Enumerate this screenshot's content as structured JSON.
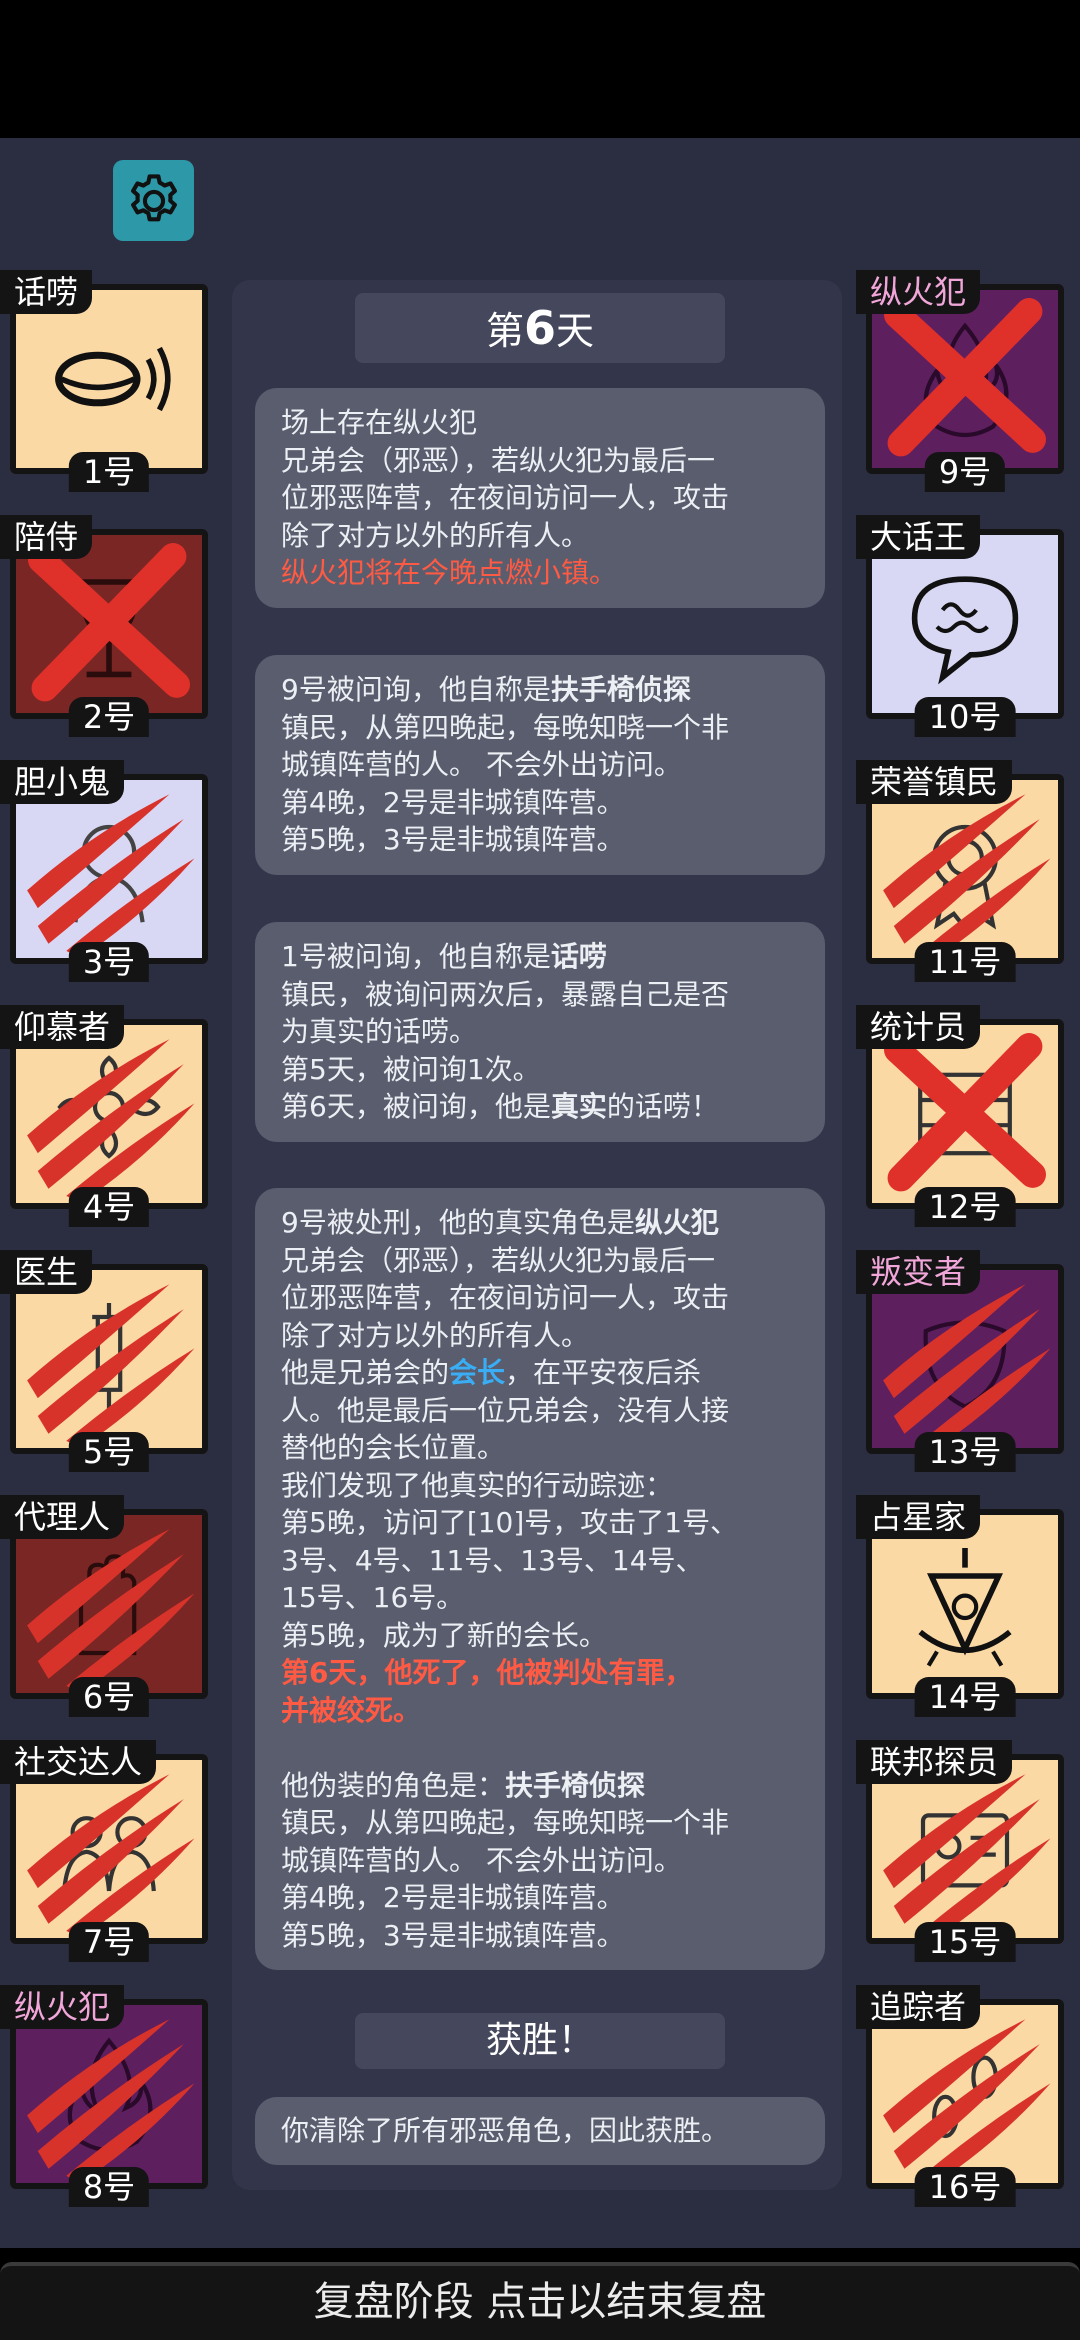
{
  "settings_icon": "gear-icon",
  "day": {
    "prefix": "第",
    "number": "6",
    "suffix": "天"
  },
  "players_left": [
    {
      "role": "话唠",
      "number": "1号",
      "bg": "#fbd9a4",
      "evil": false,
      "mark": "none",
      "icon": "mouth-speaking-icon"
    },
    {
      "role": "陪侍",
      "number": "2号",
      "bg": "#7a2624",
      "evil": false,
      "mark": "cross",
      "icon": "wine-glass-icon"
    },
    {
      "role": "胆小鬼",
      "number": "3号",
      "bg": "#d8d8f4",
      "evil": false,
      "mark": "claw",
      "icon": "coward-icon"
    },
    {
      "role": "仰慕者",
      "number": "4号",
      "bg": "#fbd9a4",
      "evil": false,
      "mark": "claw",
      "icon": "flower-icon"
    },
    {
      "role": "医生",
      "number": "5号",
      "bg": "#fbd9a4",
      "evil": false,
      "mark": "claw",
      "icon": "syringe-icon"
    },
    {
      "role": "代理人",
      "number": "6号",
      "bg": "#7a2624",
      "evil": false,
      "mark": "claw",
      "icon": "hand-icon"
    },
    {
      "role": "社交达人",
      "number": "7号",
      "bg": "#fbd9a4",
      "evil": false,
      "mark": "claw",
      "icon": "people-icon"
    },
    {
      "role": "纵火犯",
      "number": "8号",
      "bg": "#5e1f5e",
      "evil": true,
      "mark": "claw",
      "icon": "fire-icon"
    }
  ],
  "players_right": [
    {
      "role": "纵火犯",
      "number": "9号",
      "bg": "#5e1f5e",
      "evil": true,
      "mark": "cross",
      "icon": "fire-icon"
    },
    {
      "role": "大话王",
      "number": "10号",
      "bg": "#d8d8f4",
      "evil": false,
      "mark": "none",
      "icon": "speech-bubble-icon"
    },
    {
      "role": "荣誉镇民",
      "number": "11号",
      "bg": "#fbd9a4",
      "evil": false,
      "mark": "claw",
      "icon": "medal-icon"
    },
    {
      "role": "统计员",
      "number": "12号",
      "bg": "#fbd9a4",
      "evil": false,
      "mark": "cross",
      "icon": "abacus-icon"
    },
    {
      "role": "叛变者",
      "number": "13号",
      "bg": "#5e1f5e",
      "evil": true,
      "mark": "claw",
      "icon": "mask-icon"
    },
    {
      "role": "占星家",
      "number": "14号",
      "bg": "#fbd9a4",
      "evil": false,
      "mark": "none",
      "icon": "sextant-icon"
    },
    {
      "role": "联邦探员",
      "number": "15号",
      "bg": "#fbd9a4",
      "evil": false,
      "mark": "claw",
      "icon": "badge-icon"
    },
    {
      "role": "追踪者",
      "number": "16号",
      "bg": "#fbd9a4",
      "evil": false,
      "mark": "claw",
      "icon": "footprints-icon"
    }
  ],
  "messages": [
    [
      [
        {
          "t": "场上存在纵火犯"
        }
      ],
      [
        {
          "t": "兄弟会（邪恶），若纵火犯为最后一"
        }
      ],
      [
        {
          "t": "位邪恶阵营，在夜间访问一人，攻击"
        }
      ],
      [
        {
          "t": "除了对方以外的所有人。"
        }
      ],
      [
        {
          "t": "纵火犯将在今晚点燃小镇。",
          "s": "red"
        }
      ]
    ],
    [
      [
        {
          "t": "9号被问询，他自称是"
        },
        {
          "t": "扶手椅侦探",
          "s": "bold"
        }
      ],
      [
        {
          "t": "镇民，从第四晚起，每晚知晓一个非"
        }
      ],
      [
        {
          "t": "城镇阵营的人。 不会外出访问。"
        }
      ],
      [
        {
          "t": "第4晚，2号是非城镇阵营。"
        }
      ],
      [
        {
          "t": "第5晚，3号是非城镇阵营。"
        }
      ]
    ],
    [
      [
        {
          "t": "1号被问询，他自称是"
        },
        {
          "t": "话唠",
          "s": "bold"
        }
      ],
      [
        {
          "t": "镇民，被询问两次后，暴露自己是否"
        }
      ],
      [
        {
          "t": "为真实的话唠。"
        }
      ],
      [
        {
          "t": "第5天，被问询1次。"
        }
      ],
      [
        {
          "t": "第6天，被问询，他是"
        },
        {
          "t": "真实",
          "s": "bold"
        },
        {
          "t": "的话唠！"
        }
      ]
    ],
    [
      [
        {
          "t": "9号被处刑，他的真实角色是"
        },
        {
          "t": "纵火犯",
          "s": "bold"
        }
      ],
      [
        {
          "t": "兄弟会（邪恶），若纵火犯为最后一"
        }
      ],
      [
        {
          "t": "位邪恶阵营，在夜间访问一人，攻击"
        }
      ],
      [
        {
          "t": "除了对方以外的所有人。"
        }
      ],
      [
        {
          "t": "他是兄弟会的"
        },
        {
          "t": "会长",
          "s": "blue"
        },
        {
          "t": "，在平安夜后杀"
        }
      ],
      [
        {
          "t": "人。他是最后一位兄弟会，没有人接"
        }
      ],
      [
        {
          "t": "替他的会长位置。"
        }
      ],
      [
        {
          "t": "我们发现了他真实的行动踪迹："
        }
      ],
      [
        {
          "t": "第5晚，访问了[10]号，攻击了1号、"
        }
      ],
      [
        {
          "t": "3号、4号、11号、13号、14号、"
        }
      ],
      [
        {
          "t": "15号、16号。"
        }
      ],
      [
        {
          "t": "第5晚，成为了新的会长。"
        }
      ],
      [
        {
          "t": "第6天，他死了，他被判处有罪，",
          "s": "red bold"
        }
      ],
      [
        {
          "t": "并被绞死。",
          "s": "red bold"
        }
      ],
      [
        {
          "t": ""
        }
      ],
      [
        {
          "t": "他伪装的角色是："
        },
        {
          "t": "扶手椅侦探",
          "s": "bold"
        }
      ],
      [
        {
          "t": "镇民，从第四晚起，每晚知晓一个非"
        }
      ],
      [
        {
          "t": "城镇阵营的人。 不会外出访问。"
        }
      ],
      [
        {
          "t": "第4晚，2号是非城镇阵营。"
        }
      ],
      [
        {
          "t": "第5晚，3号是非城镇阵营。"
        }
      ]
    ]
  ],
  "win_title": "获胜！",
  "win_message": "你清除了所有邪恶角色，因此获胜。",
  "bottom_bar": "复盘阶段 点击以结束复盘"
}
